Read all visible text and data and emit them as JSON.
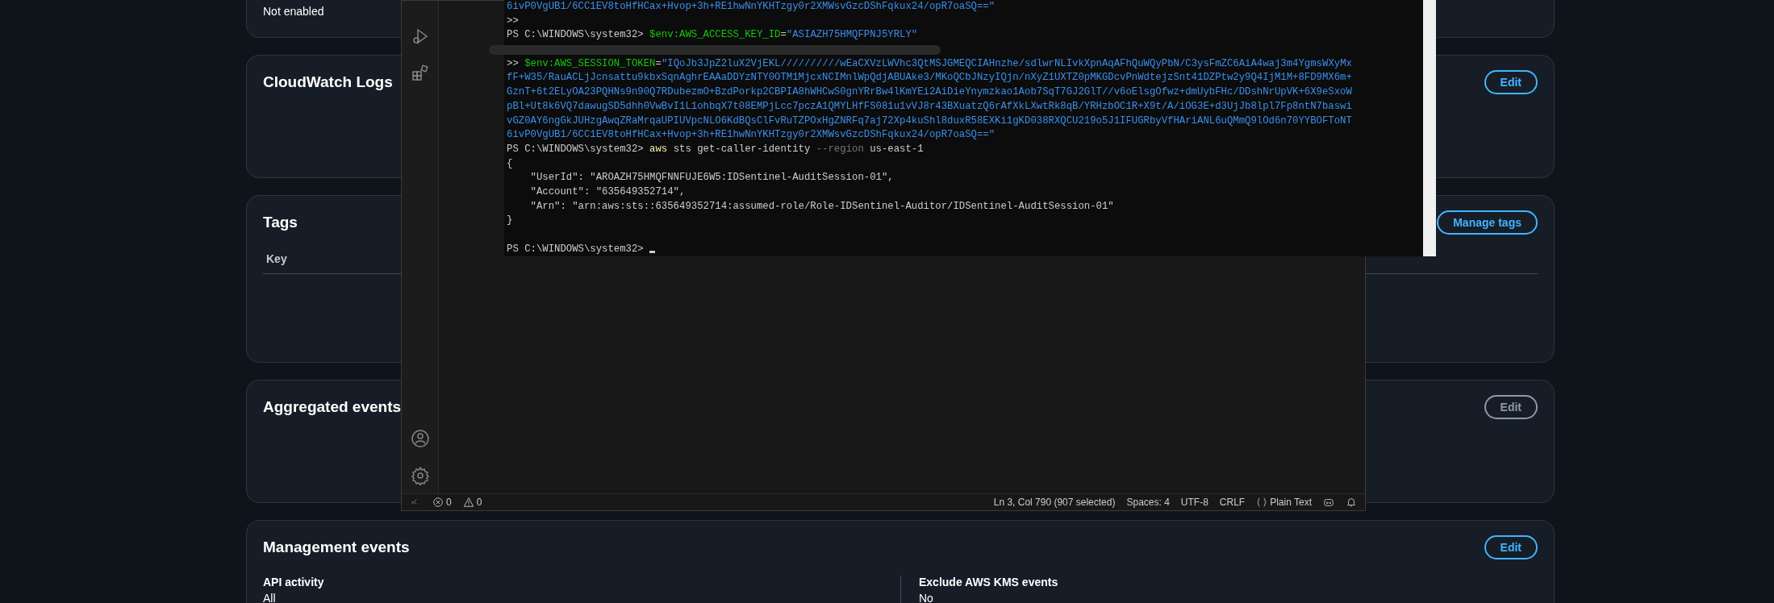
{
  "cards": [
    {
      "kind": "partial",
      "fields": [
        {
          "value": "Not enabled"
        }
      ]
    },
    {
      "kind": "simple",
      "title": "CloudWatch Logs",
      "button": {
        "label": "Edit",
        "disabled": false
      }
    },
    {
      "kind": "table",
      "title": "Tags",
      "button": {
        "label": "Manage tags",
        "disabled": false
      },
      "columns": [
        "Key"
      ]
    },
    {
      "kind": "simple",
      "title": "Aggregated events",
      "button": {
        "label": "Edit",
        "disabled": true
      }
    },
    {
      "kind": "fields",
      "title": "Management events",
      "button": {
        "label": "Edit",
        "disabled": false
      },
      "fields": [
        {
          "label": "API activity",
          "value": "All"
        },
        {
          "label": "Exclude AWS KMS events",
          "value": "No"
        }
      ]
    }
  ],
  "terminal": {
    "lines": [
      {
        "kind": "text",
        "segments": [
          {
            "kind": "string",
            "text": "6ivP0VgUB1/6CC1EV8toHfHCax+Hvop+3h+RE1hwNnYKHTzgy0r2XMWsvGzcDShFqkux24/opR7oaSQ==\""
          }
        ]
      },
      {
        "kind": "text",
        "segments": [
          {
            "kind": "plain",
            "text": ">>"
          }
        ]
      },
      {
        "kind": "text",
        "segments": [
          {
            "kind": "plain",
            "text": "PS C:\\WINDOWS\\system32> "
          },
          {
            "kind": "variable",
            "text": "$env:AWS_ACCESS_KEY_ID"
          },
          {
            "kind": "plain",
            "text": "="
          },
          {
            "kind": "string",
            "text": "\"ASIAZH75HMQFPNJ5YRLY\""
          }
        ]
      },
      {
        "kind": "redacted"
      },
      {
        "kind": "text",
        "segments": [
          {
            "kind": "plain",
            "text": ">> "
          },
          {
            "kind": "variable",
            "text": "$env:AWS_SESSION_TOKEN"
          },
          {
            "kind": "plain",
            "text": "="
          },
          {
            "kind": "string",
            "text": "\"IQoJb3JpZ2luX2VjEKL//////////wEaCXVzLWVhc3QtMSJGMEQCIAHnzhe/sdlwrNLIvkXpnAqAFhQuWQyPbN/C3ysFmZC6AiA4waj3m4YgmsWXyMx"
          }
        ]
      },
      {
        "kind": "text",
        "segments": [
          {
            "kind": "string",
            "text": "fF+W35/RauACLjJcnsattu9kbxSqnAghrEAAaDDYzNTY0OTM1MjcxNCIMnlWpQdjABUAke3/MKoQCbJNzyIQjn/nXyZ1UXTZ0pMKGDcvPnWdtejzSnt41DZPtw2y9Q4IjM1M+8FD9MX6m+"
          }
        ]
      },
      {
        "kind": "text",
        "segments": [
          {
            "kind": "string",
            "text": "GznT+6t2ELyOA23PQHNs9n90Q7RDubezmO+BzdPorkp2CBPIA8hWHCwS0gnYRrBw4lKmYEi2AiDieYnymzkao1Aob7SqT7GJ2GlT//v6oElsgOfwz+dmUybFHc/DDshNrUpVK+6X9eSxoW"
          }
        ]
      },
      {
        "kind": "text",
        "segments": [
          {
            "kind": "string",
            "text": "pBl+Ut8k6VQ7dawugSD5dhh0VwBvI1L1ohbqX7t08EMPjLcc7pczA1QMYLHfFS081u1vVJ8r43BXuatzQ6rAfXkLXwtRk8qB/YRHzbOC1R+X9t/A/iOG3E+d3UjJb8lpl7Fp8ntN7baswi"
          }
        ]
      },
      {
        "kind": "text",
        "segments": [
          {
            "kind": "string",
            "text": "vGZ0AY6ngGkJUHzgAwqZRaMrqaUPIUVpcNLO6KdBQsClFvRuTZPOxHgZNRFq7aj72Xp4kuShl8duxR58EXKi1gKD038RXQCU219o5J1IFUGRbyVfHAriANL6uQMmQ9lOd6n70YYBOFToNT"
          }
        ]
      },
      {
        "kind": "text",
        "segments": [
          {
            "kind": "string",
            "text": "6ivP0VgUB1/6CC1EV8toHfHCax+Hvop+3h+RE1hwNnYKHTzgy0r2XMWsvGzcDShFqkux24/opR7oaSQ==\""
          }
        ]
      },
      {
        "kind": "text",
        "segments": [
          {
            "kind": "plain",
            "text": "PS C:\\WINDOWS\\system32> "
          },
          {
            "kind": "command",
            "text": "aws"
          },
          {
            "kind": "plain",
            "text": " sts get-caller-identity "
          },
          {
            "kind": "flag",
            "text": "--region"
          },
          {
            "kind": "plain",
            "text": " us-east-1"
          }
        ]
      },
      {
        "kind": "text",
        "segments": [
          {
            "kind": "plain",
            "text": "{"
          }
        ]
      },
      {
        "kind": "text",
        "segments": [
          {
            "kind": "plain",
            "text": "    \"UserId\": \"AROAZH75HMQFNNFUJE6W5:IDSentinel-AuditSession-01\","
          }
        ]
      },
      {
        "kind": "text",
        "segments": [
          {
            "kind": "plain",
            "text": "    \"Account\": \"635649352714\","
          }
        ]
      },
      {
        "kind": "text",
        "segments": [
          {
            "kind": "plain",
            "text": "    \"Arn\": \"arn:aws:sts::635649352714:assumed-role/Role-IDSentinel-Auditor/IDSentinel-AuditSession-01\""
          }
        ]
      },
      {
        "kind": "text",
        "segments": [
          {
            "kind": "plain",
            "text": "}"
          }
        ]
      },
      {
        "kind": "blank"
      },
      {
        "kind": "text",
        "cursor": true,
        "segments": [
          {
            "kind": "plain",
            "text": "PS C:\\WINDOWS\\system32> "
          }
        ]
      }
    ]
  },
  "status_bar": {
    "errors": "0",
    "warnings": "0",
    "items": [
      "Ln 3, Col 790 (907 selected)",
      "Spaces: 4",
      "UTF-8",
      "CRLF"
    ],
    "language": "Plain Text"
  }
}
